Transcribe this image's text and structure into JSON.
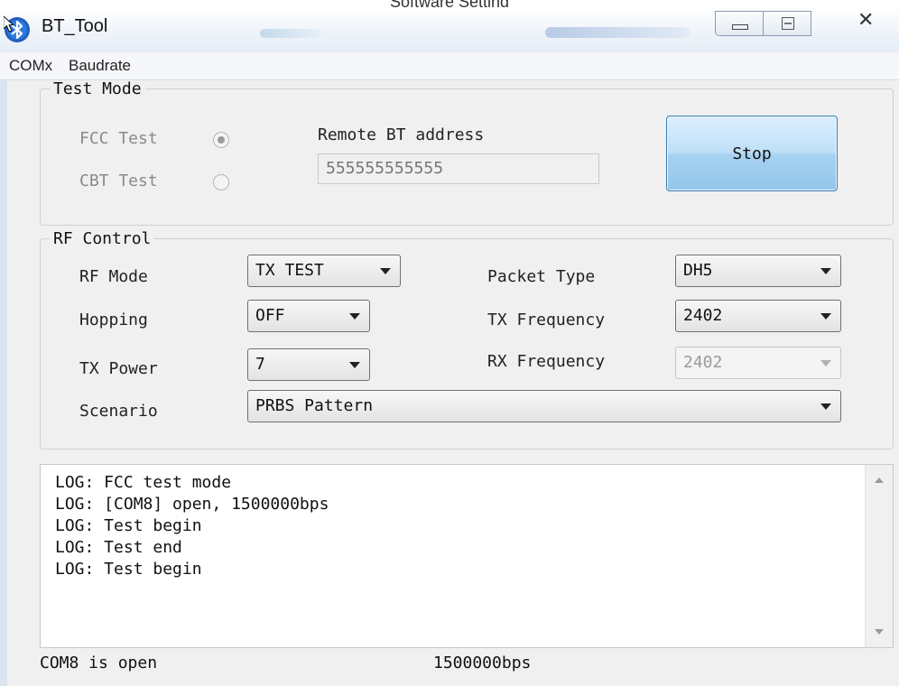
{
  "caption": "Software Setting",
  "window": {
    "title": "BT_Tool",
    "icon": "bluetooth-icon"
  },
  "menu": {
    "items": [
      "COMx",
      "Baudrate"
    ]
  },
  "test_mode": {
    "legend": "Test Mode",
    "fcc_label": "FCC Test",
    "cbt_label": "CBT Test",
    "selected": "FCC Test",
    "remote_addr_label": "Remote BT address",
    "remote_addr_value": "555555555555",
    "stop_button": "Stop"
  },
  "rf_control": {
    "legend": "RF Control",
    "rf_mode_label": "RF Mode",
    "rf_mode_value": "TX TEST",
    "hopping_label": "Hopping",
    "hopping_value": "OFF",
    "tx_power_label": "TX Power",
    "tx_power_value": "7",
    "scenario_label": "Scenario",
    "scenario_value": "PRBS Pattern",
    "packet_type_label": "Packet Type",
    "packet_type_value": "DH5",
    "tx_freq_label": "TX Frequency",
    "tx_freq_value": "2402",
    "rx_freq_label": "RX Frequency",
    "rx_freq_value": "2402"
  },
  "log": {
    "lines": [
      "LOG: FCC test mode",
      "LOG: [COM8] open, 1500000bps",
      "LOG: Test begin",
      "LOG: Test end",
      "LOG: Test begin"
    ]
  },
  "status": {
    "port": "COM8 is open",
    "baud": "1500000bps"
  }
}
